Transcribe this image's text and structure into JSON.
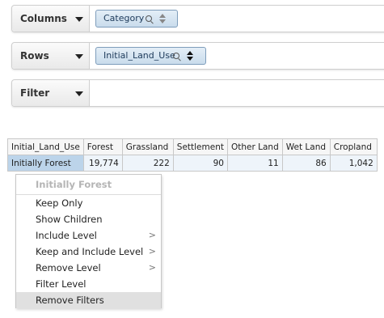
{
  "shelves": {
    "columns": {
      "label": "Columns",
      "pill": "Category"
    },
    "rows": {
      "label": "Rows",
      "pill": "Initial_Land_Use"
    },
    "filter": {
      "label": "Filter"
    }
  },
  "table": {
    "headers": [
      "Initial_Land_Use",
      "Forest",
      "Grassland",
      "Settlement",
      "Other Land",
      "Wet Land",
      "Cropland"
    ],
    "row_label": "Initially Forest",
    "values": [
      "19,774",
      "222",
      "90",
      "11",
      "86",
      "1,042"
    ]
  },
  "menu": {
    "title": "Initially Forest",
    "items": [
      {
        "label": "Keep Only",
        "submenu": ""
      },
      {
        "label": "Show Children",
        "submenu": ""
      },
      {
        "label": "Include Level",
        "submenu": ">"
      },
      {
        "label": "Keep and Include Level",
        "submenu": ">"
      },
      {
        "label": "Remove Level",
        "submenu": ">"
      },
      {
        "label": "Filter Level",
        "submenu": ""
      },
      {
        "label": "Remove Filters",
        "submenu": ""
      }
    ]
  }
}
